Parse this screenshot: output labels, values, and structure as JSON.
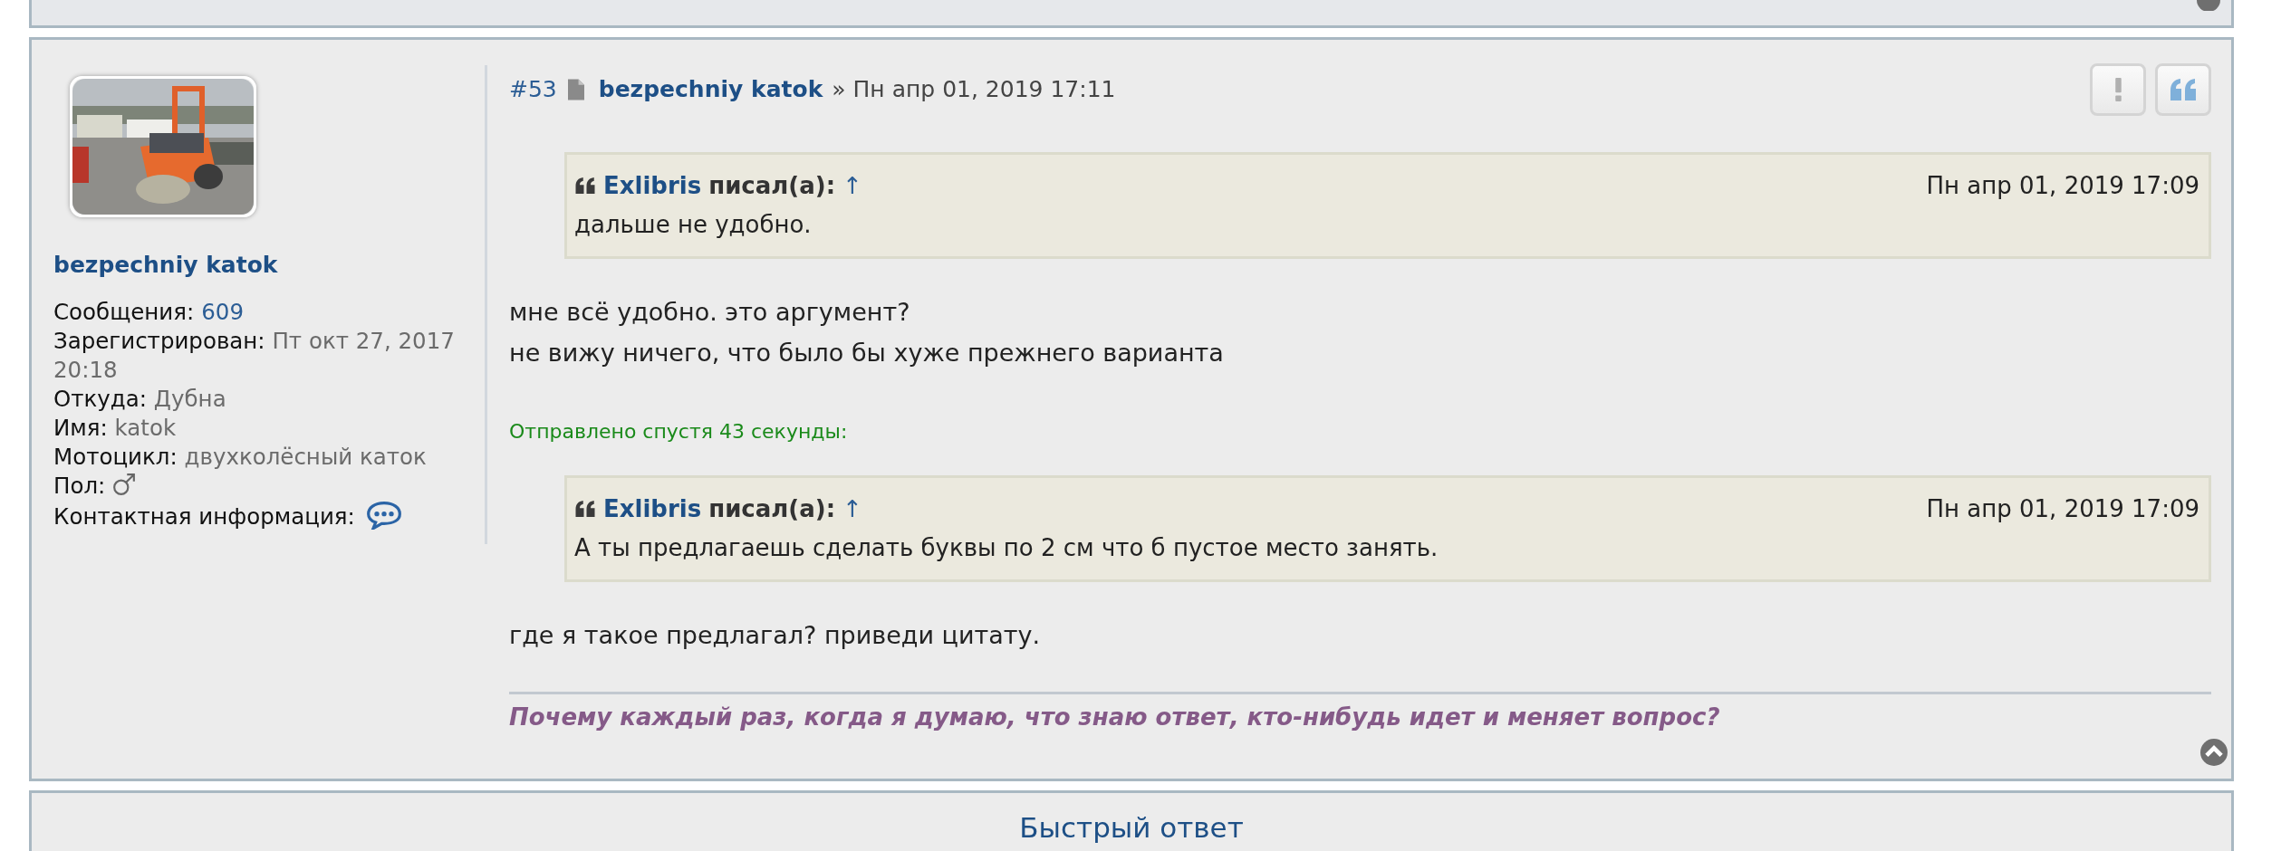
{
  "post": {
    "profile": {
      "name": "bezpechniy katok",
      "fields": [
        {
          "label": "Сообщения:",
          "value": "609",
          "kind": "link"
        },
        {
          "label": "Зарегистрирован:",
          "value": "Пт окт 27, 2017 20:18",
          "kind": "text"
        },
        {
          "label": "Откуда:",
          "value": "Дубна",
          "kind": "text"
        },
        {
          "label": "Имя:",
          "value": "katok",
          "kind": "text"
        },
        {
          "label": "Мотоцикл:",
          "value": "двухколёсный каток",
          "kind": "text"
        },
        {
          "label": "Пол:",
          "kind": "male"
        },
        {
          "label": "Контактная информация:",
          "kind": "contact"
        }
      ]
    },
    "number": "#53",
    "author": "bezpechniy katok",
    "separator": "»",
    "time": "Пн апр 01, 2019 17:11",
    "actions": [
      {
        "kind": "report"
      },
      {
        "kind": "quote"
      }
    ],
    "content": [
      {
        "kind": "quote",
        "author": "Exlibris",
        "wrote": "писал(а):",
        "arrow": "↑",
        "date": "Пн апр 01, 2019 17:09",
        "text": "дальше не удобно."
      },
      {
        "kind": "paragraph",
        "lines": [
          "мне всё удобно. это аргумент?",
          "не вижу ничего, что было бы хуже прежнего варианта"
        ]
      },
      {
        "kind": "notice",
        "text": "Отправлено спустя 43 секунды:"
      },
      {
        "kind": "quote",
        "author": "Exlibris",
        "wrote": "писал(а):",
        "arrow": "↑",
        "date": "Пн апр 01, 2019 17:09",
        "text": "А ты предлагаешь сделать буквы по 2 см что б пустое место занять."
      },
      {
        "kind": "paragraph",
        "lines": [
          "где я такое предлагал? приведи цитату."
        ]
      }
    ],
    "signature": "Почему каждый раз, когда я думаю, что знаю ответ, кто-нибудь идет и меняет вопрос?"
  },
  "quick_reply": {
    "title": "Быстрый ответ"
  }
}
